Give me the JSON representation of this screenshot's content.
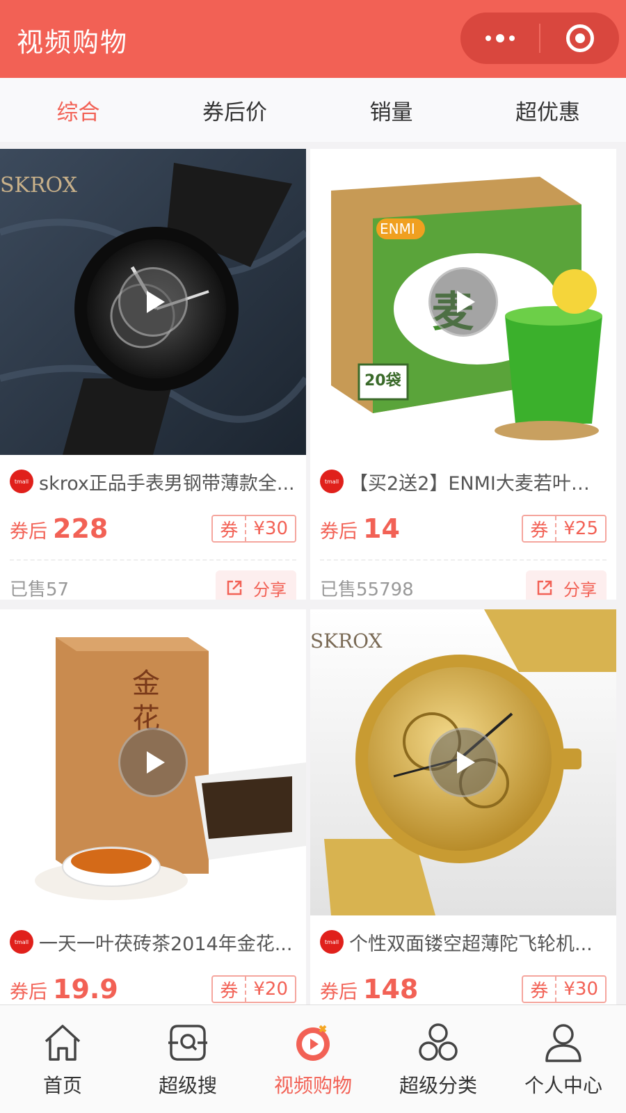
{
  "header": {
    "title": "视频购物",
    "more_icon": "more-dots-icon",
    "close_icon": "target-icon"
  },
  "sort_tabs": [
    {
      "label": "综合",
      "active": true
    },
    {
      "label": "券后价",
      "active": false
    },
    {
      "label": "销量",
      "active": false
    },
    {
      "label": "超优惠",
      "active": false
    }
  ],
  "products": [
    {
      "name": "skrox正品手表男钢带薄款全...",
      "price_label": "券后",
      "price": "228",
      "coupon_label": "券",
      "coupon_amount": "¥30",
      "sold": "已售57",
      "share": "分享"
    },
    {
      "name": "【买2送2】ENMI大麦若叶青...",
      "price_label": "券后",
      "price": "14",
      "coupon_label": "券",
      "coupon_amount": "¥25",
      "sold": "已售55798",
      "share": "分享"
    },
    {
      "name": "一天一叶茯砖茶2014年金花...",
      "price_label": "券后",
      "price": "19.9",
      "coupon_label": "券",
      "coupon_amount": "¥20"
    },
    {
      "name": "个性双面镂空超薄陀飞轮机...",
      "price_label": "券后",
      "price": "148",
      "coupon_label": "券",
      "coupon_amount": "¥30"
    }
  ],
  "tabbar": [
    {
      "label": "首页",
      "icon": "home-icon",
      "active": false
    },
    {
      "label": "超级搜",
      "icon": "search-scan-icon",
      "active": false
    },
    {
      "label": "视频购物",
      "icon": "video-shopping-icon",
      "active": true
    },
    {
      "label": "超级分类",
      "icon": "category-icon",
      "active": false
    },
    {
      "label": "个人中心",
      "icon": "user-icon",
      "active": false
    }
  ],
  "colors": {
    "brand": "#f26155",
    "capsule": "#d9473e",
    "background": "#f3f2f4"
  }
}
